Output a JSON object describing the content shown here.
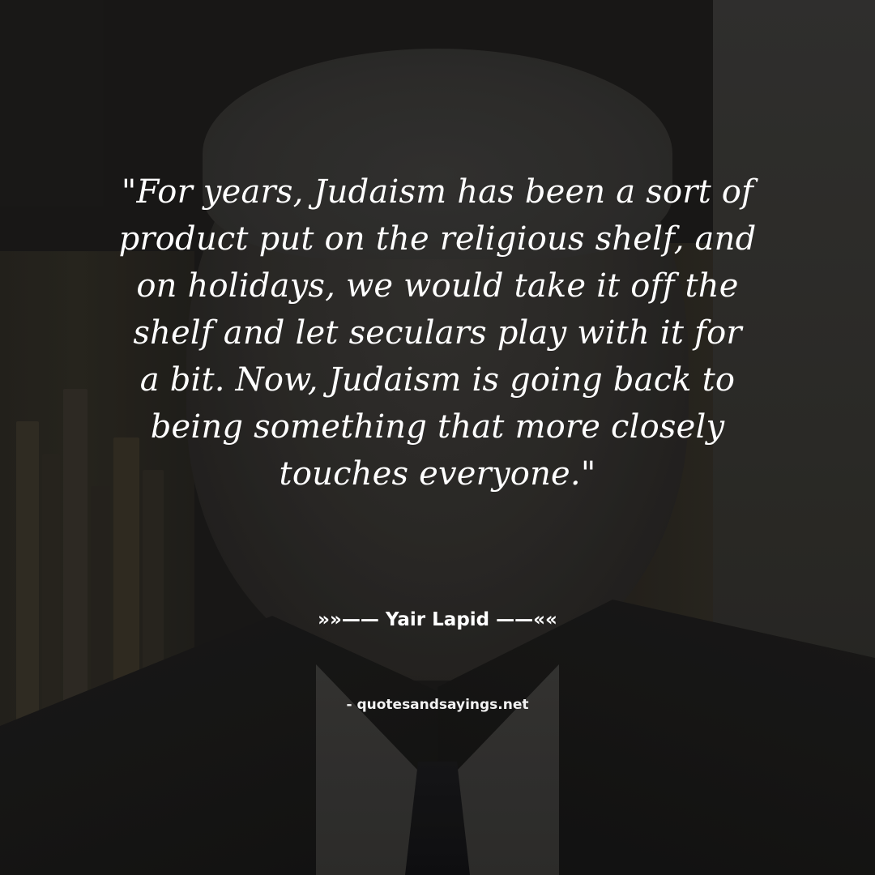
{
  "quote": {
    "lines": [
      "\"For years, Judaism has been a sort of",
      "product put on the religious shelf, and",
      "on holidays, we would take it off the",
      "shelf and let seculars play with it for",
      "a bit. Now, Judaism is going back to",
      "being something that more closely",
      "touches everyone.\""
    ]
  },
  "author": {
    "text": "»»—— Yair Lapid ——««"
  },
  "source": {
    "text": "- quotesandsayings.net"
  },
  "colors": {
    "text": "#ffffff",
    "background": "#1e1d1c"
  }
}
